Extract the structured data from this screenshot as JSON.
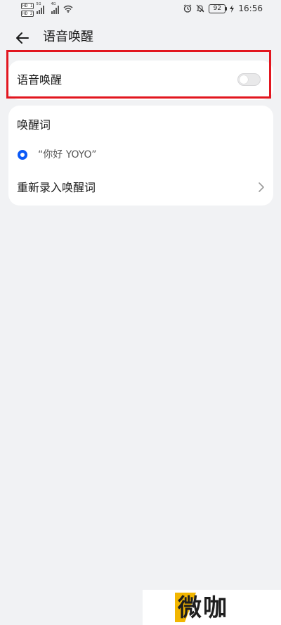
{
  "status_bar": {
    "hd_top": "HD 1",
    "hd_bottom": "HD 2",
    "net_1": "5G",
    "net_2": "4G",
    "battery": "92",
    "time": "16:56",
    "icons": [
      "hd-icon",
      "signal-icon",
      "wifi-icon",
      "alarm-icon",
      "mute-icon",
      "battery-icon"
    ]
  },
  "app_bar": {
    "title": "语音唤醒",
    "back_icon": "arrow-left-icon"
  },
  "voice_wakeup": {
    "label": "语音唤醒",
    "enabled": false
  },
  "wake_words": {
    "section_title": "唤醒词",
    "option_label": "“你好 YOYO”",
    "option_selected": true,
    "rerecord_label": "重新录入唤醒词"
  },
  "colors": {
    "accent": "#0a59f7",
    "highlight": "#e2161f",
    "background": "#f1f2f4",
    "watermark_accent": "#f2b600"
  },
  "watermark": {
    "text": "微咖"
  }
}
